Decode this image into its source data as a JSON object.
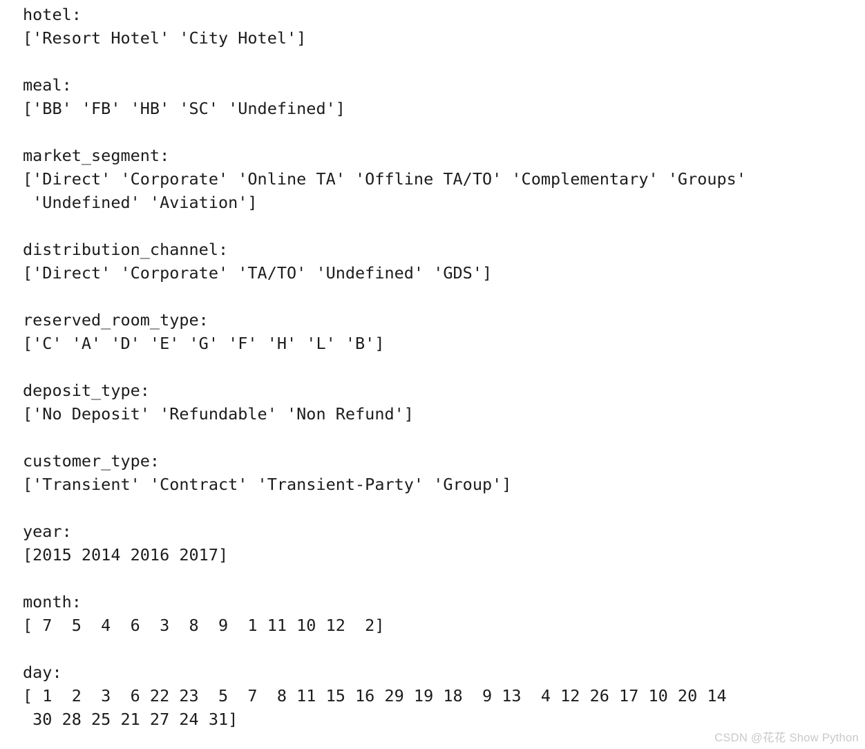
{
  "output": {
    "kind": "python-console-output",
    "blocks": [
      {
        "name": "hotel",
        "key_line": "hotel:",
        "value_lines": [
          "['Resort Hotel' 'City Hotel']"
        ],
        "values": [
          "Resort Hotel",
          "City Hotel"
        ]
      },
      {
        "name": "meal",
        "key_line": "meal:",
        "value_lines": [
          "['BB' 'FB' 'HB' 'SC' 'Undefined']"
        ],
        "values": [
          "BB",
          "FB",
          "HB",
          "SC",
          "Undefined"
        ]
      },
      {
        "name": "market_segment",
        "key_line": "market_segment:",
        "value_lines": [
          "['Direct' 'Corporate' 'Online TA' 'Offline TA/TO' 'Complementary' 'Groups'",
          " 'Undefined' 'Aviation']"
        ],
        "values": [
          "Direct",
          "Corporate",
          "Online TA",
          "Offline TA/TO",
          "Complementary",
          "Groups",
          "Undefined",
          "Aviation"
        ]
      },
      {
        "name": "distribution_channel",
        "key_line": "distribution_channel:",
        "value_lines": [
          "['Direct' 'Corporate' 'TA/TO' 'Undefined' 'GDS']"
        ],
        "values": [
          "Direct",
          "Corporate",
          "TA/TO",
          "Undefined",
          "GDS"
        ]
      },
      {
        "name": "reserved_room_type",
        "key_line": "reserved_room_type:",
        "value_lines": [
          "['C' 'A' 'D' 'E' 'G' 'F' 'H' 'L' 'B']"
        ],
        "values": [
          "C",
          "A",
          "D",
          "E",
          "G",
          "F",
          "H",
          "L",
          "B"
        ]
      },
      {
        "name": "deposit_type",
        "key_line": "deposit_type:",
        "value_lines": [
          "['No Deposit' 'Refundable' 'Non Refund']"
        ],
        "values": [
          "No Deposit",
          "Refundable",
          "Non Refund"
        ]
      },
      {
        "name": "customer_type",
        "key_line": "customer_type:",
        "value_lines": [
          "['Transient' 'Contract' 'Transient-Party' 'Group']"
        ],
        "values": [
          "Transient",
          "Contract",
          "Transient-Party",
          "Group"
        ]
      },
      {
        "name": "year",
        "key_line": "year:",
        "value_lines": [
          "[2015 2014 2016 2017]"
        ],
        "values": [
          2015,
          2014,
          2016,
          2017
        ]
      },
      {
        "name": "month",
        "key_line": "month:",
        "value_lines": [
          "[ 7  5  4  6  3  8  9  1 11 10 12  2]"
        ],
        "values": [
          7,
          5,
          4,
          6,
          3,
          8,
          9,
          1,
          11,
          10,
          12,
          2
        ]
      },
      {
        "name": "day",
        "key_line": "day:",
        "value_lines": [
          "[ 1  2  3  6 22 23  5  7  8 11 15 16 29 19 18  9 13  4 12 26 17 10 20 14",
          " 30 28 25 21 27 24 31]"
        ],
        "values": [
          1,
          2,
          3,
          6,
          22,
          23,
          5,
          7,
          8,
          11,
          15,
          16,
          29,
          19,
          18,
          9,
          13,
          4,
          12,
          26,
          17,
          10,
          20,
          14,
          30,
          28,
          25,
          21,
          27,
          24,
          31
        ]
      }
    ]
  },
  "watermark": {
    "text": "CSDN @花花 Show Python",
    "color": "#c9c9c9"
  },
  "theme": {
    "background": "#ffffff",
    "text_color": "#1c1c1c"
  }
}
